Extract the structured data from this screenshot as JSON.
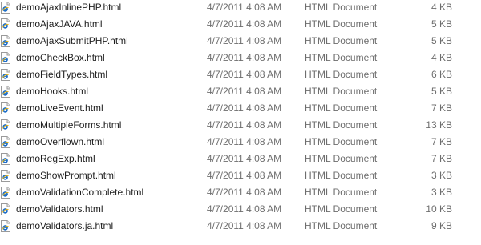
{
  "files": [
    {
      "name": "demoAjaxInlinePHP.html",
      "date": "4/7/2011 4:08 AM",
      "type": "HTML Document",
      "size": "4 KB",
      "icon": "html-file-icon"
    },
    {
      "name": "demoAjaxJAVA.html",
      "date": "4/7/2011 4:08 AM",
      "type": "HTML Document",
      "size": "5 KB",
      "icon": "html-file-icon"
    },
    {
      "name": "demoAjaxSubmitPHP.html",
      "date": "4/7/2011 4:08 AM",
      "type": "HTML Document",
      "size": "5 KB",
      "icon": "html-file-icon"
    },
    {
      "name": "demoCheckBox.html",
      "date": "4/7/2011 4:08 AM",
      "type": "HTML Document",
      "size": "4 KB",
      "icon": "html-file-icon"
    },
    {
      "name": "demoFieldTypes.html",
      "date": "4/7/2011 4:08 AM",
      "type": "HTML Document",
      "size": "6 KB",
      "icon": "html-file-icon"
    },
    {
      "name": "demoHooks.html",
      "date": "4/7/2011 4:08 AM",
      "type": "HTML Document",
      "size": "5 KB",
      "icon": "html-file-icon"
    },
    {
      "name": "demoLiveEvent.html",
      "date": "4/7/2011 4:08 AM",
      "type": "HTML Document",
      "size": "7 KB",
      "icon": "html-file-icon"
    },
    {
      "name": "demoMultipleForms.html",
      "date": "4/7/2011 4:08 AM",
      "type": "HTML Document",
      "size": "13 KB",
      "icon": "html-file-icon"
    },
    {
      "name": "demoOverflown.html",
      "date": "4/7/2011 4:08 AM",
      "type": "HTML Document",
      "size": "7 KB",
      "icon": "html-file-icon"
    },
    {
      "name": "demoRegExp.html",
      "date": "4/7/2011 4:08 AM",
      "type": "HTML Document",
      "size": "7 KB",
      "icon": "html-file-icon"
    },
    {
      "name": "demoShowPrompt.html",
      "date": "4/7/2011 4:08 AM",
      "type": "HTML Document",
      "size": "3 KB",
      "icon": "html-file-icon"
    },
    {
      "name": "demoValidationComplete.html",
      "date": "4/7/2011 4:08 AM",
      "type": "HTML Document",
      "size": "3 KB",
      "icon": "html-file-icon"
    },
    {
      "name": "demoValidators.html",
      "date": "4/7/2011 4:08 AM",
      "type": "HTML Document",
      "size": "10 KB",
      "icon": "html-file-icon"
    },
    {
      "name": "demoValidators.ja.html",
      "date": "4/7/2011 4:08 AM",
      "type": "HTML Document",
      "size": "9 KB",
      "icon": "html-file-icon"
    }
  ],
  "colors": {
    "name_text": "#1e1e1e",
    "detail_text": "#6d6d6d",
    "icon_accent": "#1f6fc8"
  }
}
